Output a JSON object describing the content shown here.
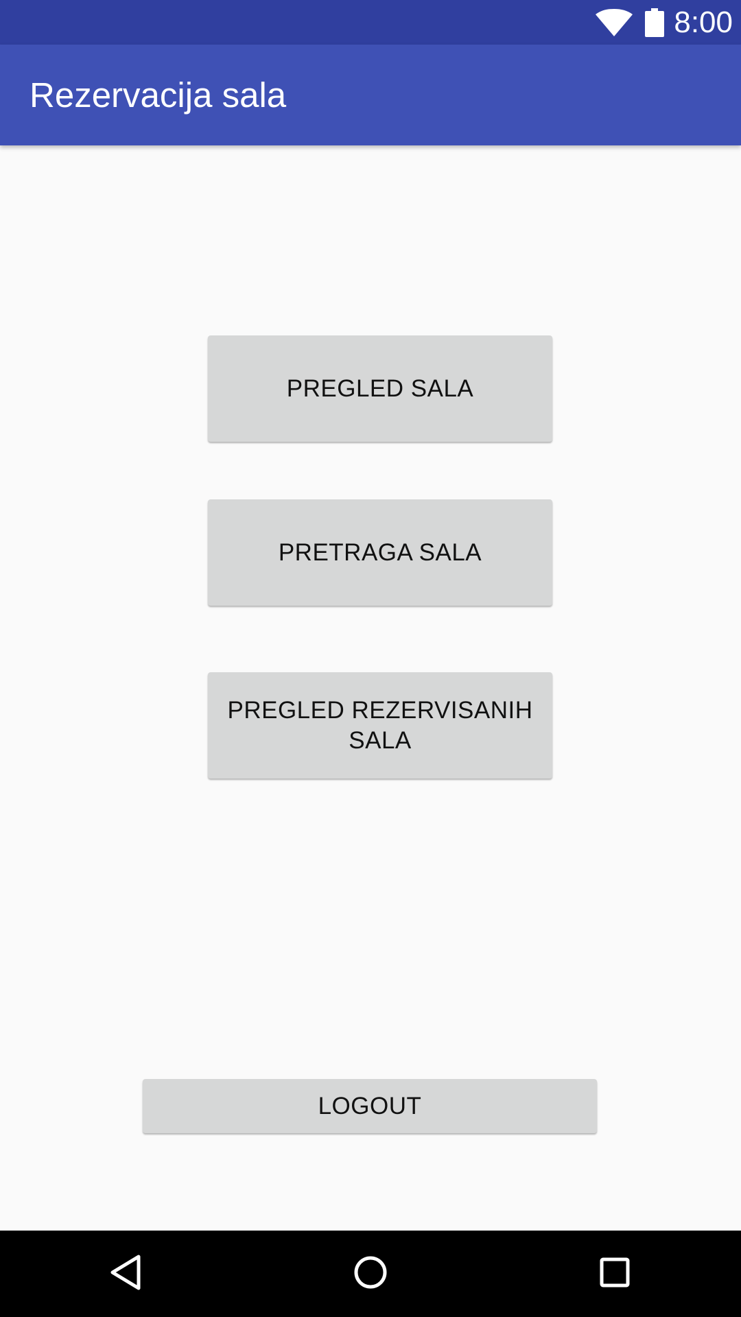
{
  "status_bar": {
    "time": "8:00",
    "icons": [
      "wifi-icon",
      "battery-icon"
    ],
    "background": "#303f9f"
  },
  "app_bar": {
    "title": "Rezervacija sala",
    "background": "#3f51b5"
  },
  "main": {
    "buttons": [
      {
        "label": "PREGLED SALA"
      },
      {
        "label": "PRETRAGA SALA"
      },
      {
        "label": "PREGLED REZERVISANIH SALA"
      }
    ],
    "logout_label": "LOGOUT"
  },
  "nav_bar": {
    "icons": [
      "back-icon",
      "home-icon",
      "recent-apps-icon"
    ]
  }
}
